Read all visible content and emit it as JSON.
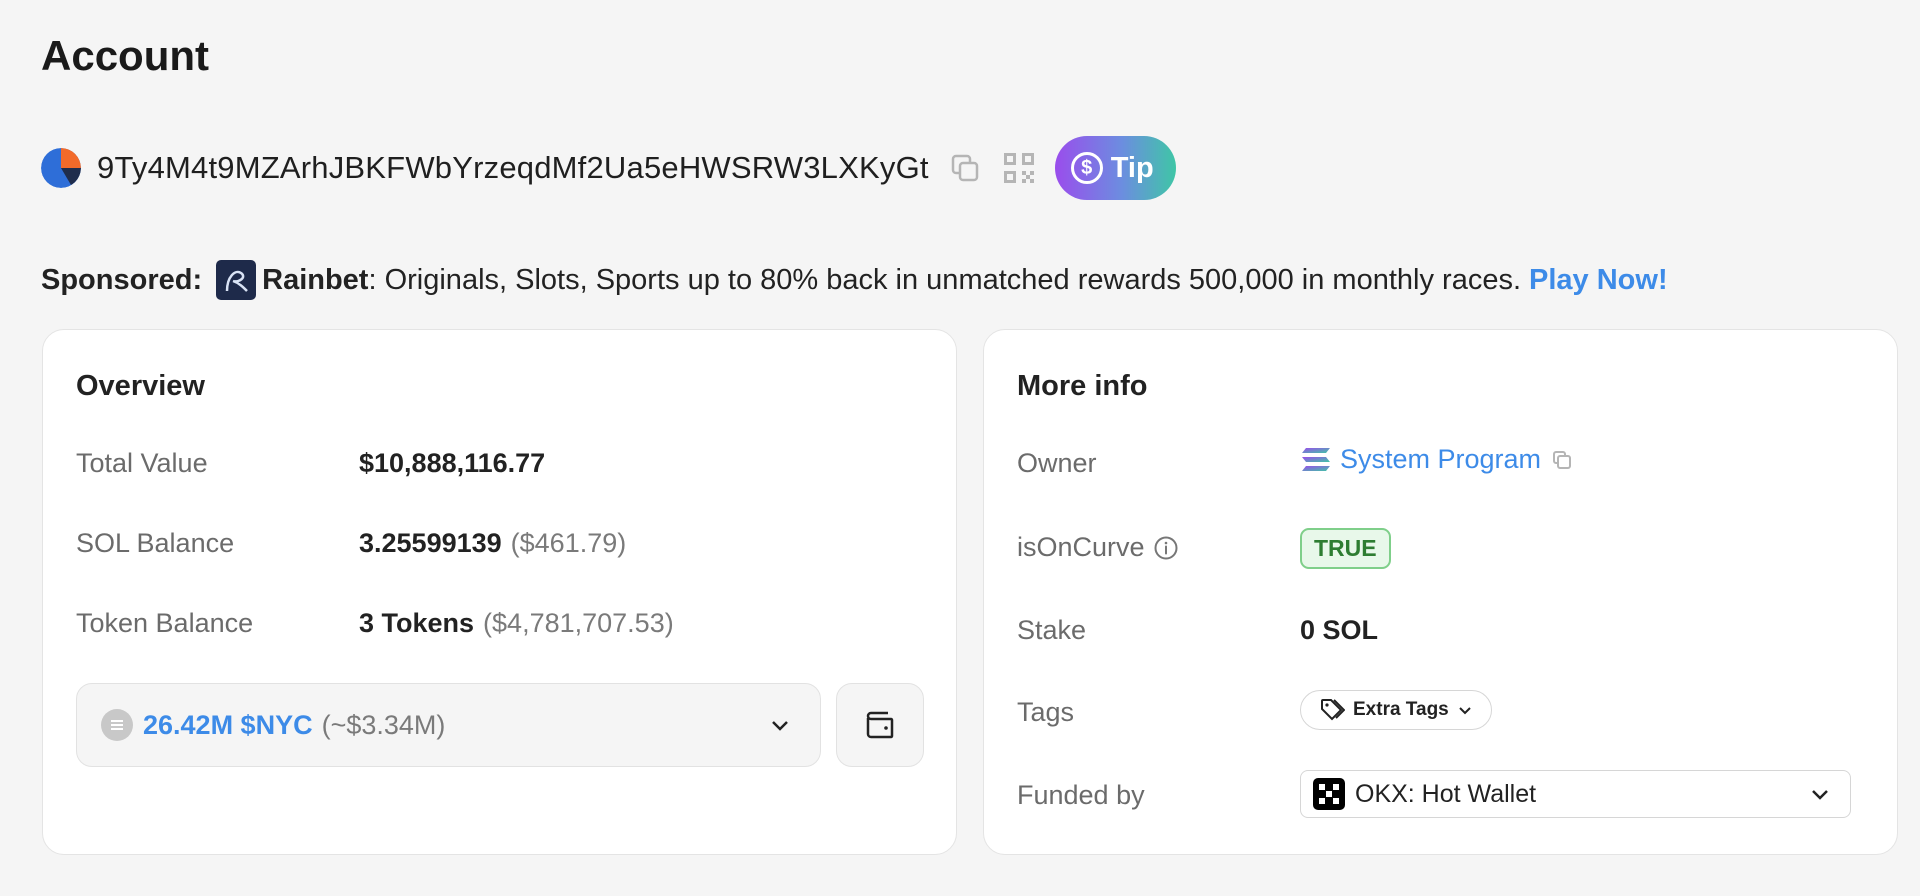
{
  "page": {
    "title": "Account"
  },
  "account": {
    "address": "9Ty4M4t9MZArhJBKFWbYrzeqdMf2Ua5eHWSRW3LXKyGt",
    "tip_label": "Tip"
  },
  "sponsor": {
    "label": "Sponsored:",
    "name": "Rainbet",
    "text": ": Originals, Slots, Sports up to 80% back in unmatched rewards 500,000 in monthly races.",
    "cta": "Play Now!"
  },
  "overview": {
    "title": "Overview",
    "rows": [
      {
        "label": "Total Value",
        "value": "$10,888,116.77",
        "sub": ""
      },
      {
        "label": "SOL Balance",
        "value": "3.25599139",
        "sub": "($461.79)"
      },
      {
        "label": "Token Balance",
        "value": "3 Tokens",
        "sub": "($4,781,707.53)"
      }
    ],
    "token_select": {
      "amount": "26.42M $NYC",
      "usd": "(~$3.34M)"
    }
  },
  "more_info": {
    "title": "More info",
    "owner": {
      "label": "Owner",
      "value": "System Program"
    },
    "on_curve": {
      "label": "isOnCurve",
      "value": "TRUE"
    },
    "stake": {
      "label": "Stake",
      "value": "0 SOL"
    },
    "tags": {
      "label": "Tags",
      "button": "Extra Tags"
    },
    "funded_by": {
      "label": "Funded by",
      "value": "OKX: Hot Wallet"
    }
  },
  "colors": {
    "accent_blue": "#3d8be8",
    "true_green": "#2e7d32",
    "tip_gradient_start": "#9a4dec",
    "tip_gradient_end": "#3fc6a6"
  }
}
